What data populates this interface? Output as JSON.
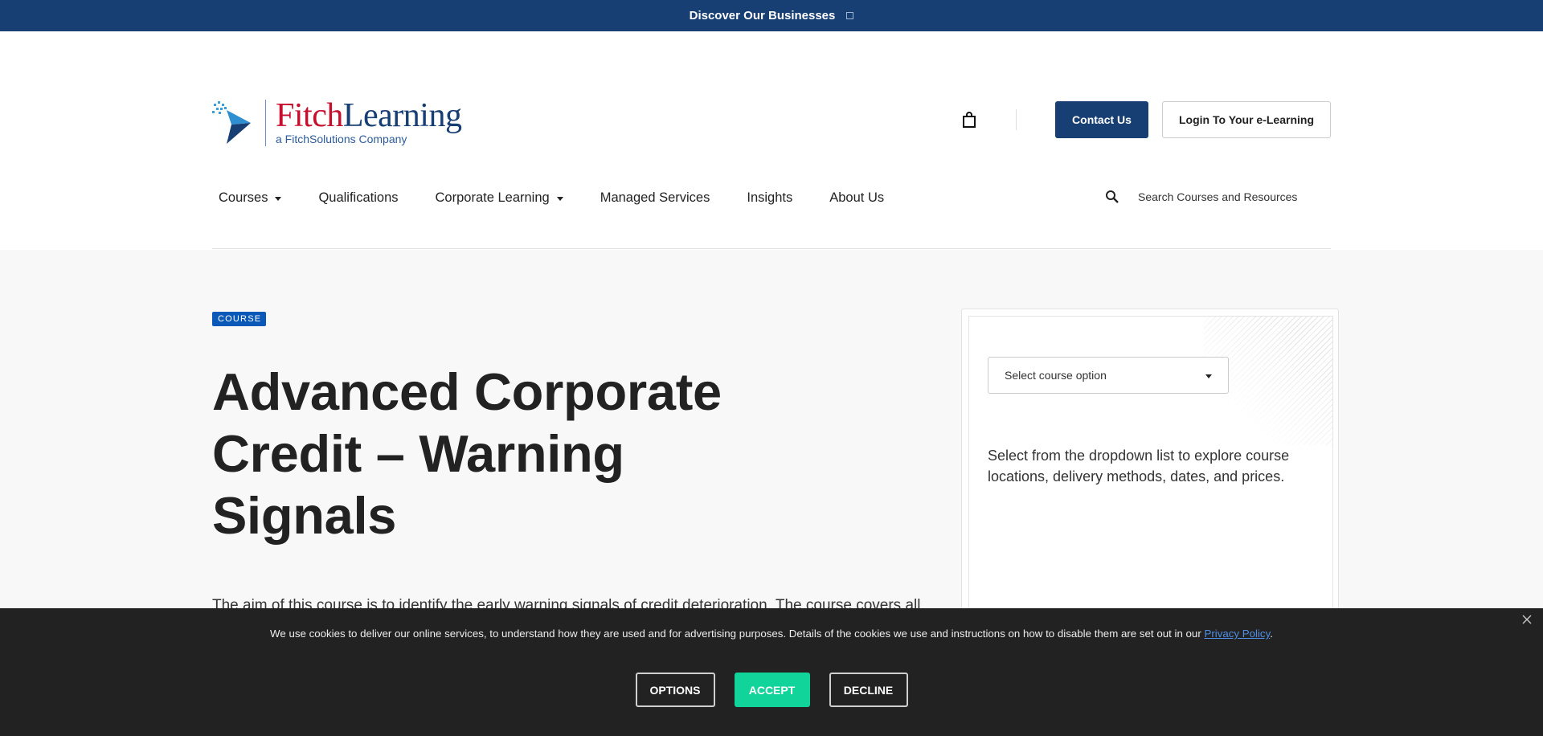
{
  "topbar": {
    "label": "Discover Our Businesses"
  },
  "logo": {
    "brand_part1": "Fitch",
    "brand_part2": "Learning",
    "tagline": "a FitchSolutions Company"
  },
  "header": {
    "contact_label": "Contact Us",
    "login_label": "Login To Your e-Learning"
  },
  "nav": {
    "items": [
      {
        "label": "Courses"
      },
      {
        "label": "Qualifications"
      },
      {
        "label": "Corporate Learning"
      },
      {
        "label": "Managed Services"
      },
      {
        "label": "Insights"
      },
      {
        "label": "About Us"
      }
    ]
  },
  "search": {
    "placeholder": "Search Courses and Resources"
  },
  "course": {
    "badge": "COURSE",
    "title": "Advanced Corporate Credit – Warning Signals",
    "description": "The aim of this course is to identify the early warning signals of credit deterioration. The course covers all"
  },
  "sidebar_card": {
    "select_label": "Select course option",
    "text": "Select from the dropdown list to explore course locations, delivery methods, dates, and prices."
  },
  "cookie": {
    "text_before": "We use cookies to deliver our online services, to understand how they are used and for advertising purposes. Details of the cookies we use and instructions on how to disable them are set out in our ",
    "link": "Privacy Policy",
    "text_after": ".",
    "options_label": "OPTIONS",
    "accept_label": "ACCEPT",
    "decline_label": "DECLINE"
  },
  "colors": {
    "brand_navy": "#183f73",
    "brand_red": "#c8102e",
    "badge_blue": "#0a59b8",
    "accept_green": "#10d49a"
  }
}
